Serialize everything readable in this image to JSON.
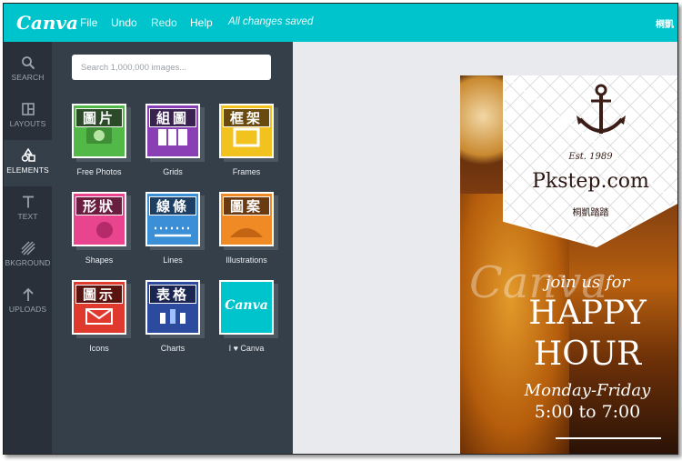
{
  "app": {
    "logo": "Canva"
  },
  "menu": {
    "file": "File",
    "undo": "Undo",
    "redo": "Redo",
    "help": "Help",
    "status": "All changes saved",
    "user": "桐凱"
  },
  "rail": [
    {
      "icon": "search-icon",
      "label": "SEARCH"
    },
    {
      "icon": "layouts-icon",
      "label": "LAYOUTS"
    },
    {
      "icon": "elements-icon",
      "label": "ELEMENTS"
    },
    {
      "icon": "text-icon",
      "label": "TEXT"
    },
    {
      "icon": "background-icon",
      "label": "BKGROUND"
    },
    {
      "icon": "upload-icon",
      "label": "UPLOADS"
    }
  ],
  "search": {
    "placeholder": "Search 1,000,000 images..."
  },
  "tiles": [
    {
      "overlay": "圖片",
      "label": "Free Photos",
      "color": "#52b848"
    },
    {
      "overlay": "組圖",
      "label": "Grids",
      "color": "#8a3fb5"
    },
    {
      "overlay": "框架",
      "label": "Frames",
      "color": "#f2c21e"
    },
    {
      "overlay": "形狀",
      "label": "Shapes",
      "color": "#e8458e"
    },
    {
      "overlay": "線條",
      "label": "Lines",
      "color": "#3b8fd6"
    },
    {
      "overlay": "圖案",
      "label": "Illustrations",
      "color": "#f08a24"
    },
    {
      "overlay": "圖示",
      "label": "Icons",
      "color": "#e03a2f"
    },
    {
      "overlay": "表格",
      "label": "Charts",
      "color": "#2c4a9e"
    },
    {
      "overlay": "",
      "label": "I ♥ Canva",
      "color": "#00c4cc",
      "logo": "Canva"
    }
  ],
  "poster": {
    "est": "Est. 1989",
    "brand": "Pkstep.com",
    "brand_cn": "桐凱踏踏",
    "join": "join us for",
    "happy": "HAPPY",
    "hour": "HOUR",
    "days": "Monday-Friday",
    "time": "5:00 to 7:00",
    "watermark": "Canva"
  }
}
